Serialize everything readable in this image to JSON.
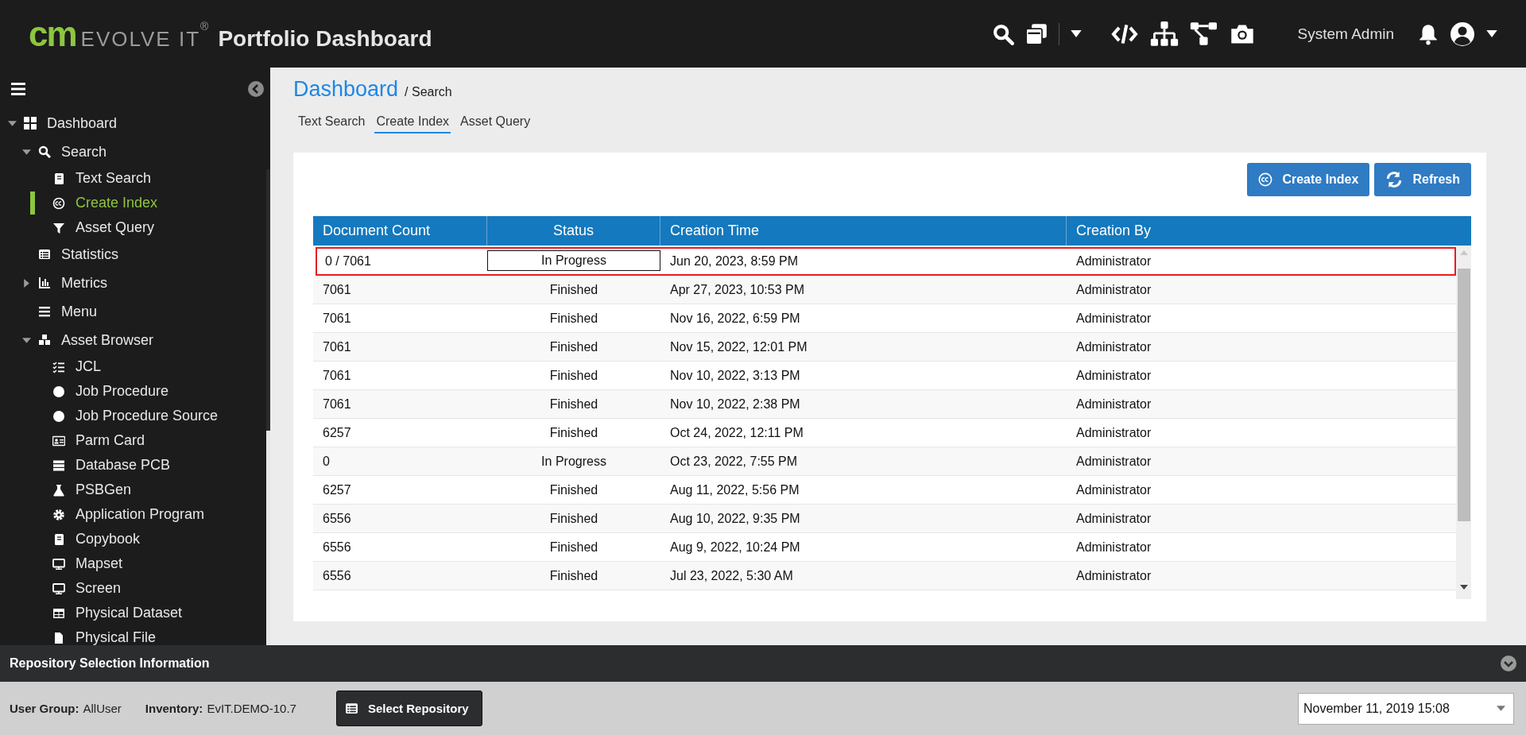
{
  "header": {
    "logo_mark": "cm",
    "logo_word": "EVOLVE IT",
    "logo_reg": "®",
    "title": "Portfolio Dashboard",
    "user": "System Admin"
  },
  "sidebar": {
    "items": [
      {
        "label": "Dashboard",
        "selected": false,
        "expanded": true,
        "children": [
          {
            "label": "Search",
            "selected": false,
            "expanded": true,
            "children": [
              {
                "label": "Text Search",
                "selected": false
              },
              {
                "label": "Create Index",
                "selected": true
              },
              {
                "label": "Asset Query",
                "selected": false
              }
            ]
          },
          {
            "label": "Statistics",
            "selected": false
          },
          {
            "label": "Metrics",
            "selected": false,
            "expanded": false
          },
          {
            "label": "Menu",
            "selected": false
          },
          {
            "label": "Asset Browser",
            "selected": false,
            "expanded": true,
            "children": [
              {
                "label": "JCL",
                "selected": false
              },
              {
                "label": "Job Procedure",
                "selected": false
              },
              {
                "label": "Job Procedure Source",
                "selected": false
              },
              {
                "label": "Parm Card",
                "selected": false
              },
              {
                "label": "Database PCB",
                "selected": false
              },
              {
                "label": "PSBGen",
                "selected": false
              },
              {
                "label": "Application Program",
                "selected": false
              },
              {
                "label": "Copybook",
                "selected": false
              },
              {
                "label": "Mapset",
                "selected": false
              },
              {
                "label": "Screen",
                "selected": false
              },
              {
                "label": "Physical Dataset",
                "selected": false
              },
              {
                "label": "Physical File",
                "selected": false
              }
            ]
          }
        ]
      }
    ]
  },
  "breadcrumb": {
    "title": "Dashboard",
    "path": "/ Search"
  },
  "tabs": [
    {
      "label": "Text Search",
      "selected": false
    },
    {
      "label": "Create Index",
      "selected": true
    },
    {
      "label": "Asset Query",
      "selected": false
    }
  ],
  "buttons": [
    {
      "label": "Create Index",
      "kind": "cc"
    },
    {
      "label": "Refresh",
      "kind": "refresh"
    }
  ],
  "table": {
    "columns": [
      "Document Count",
      "Status",
      "Creation Time",
      "Creation By"
    ],
    "rows": [
      {
        "cells": [
          "0 / 7061",
          "In Progress",
          "Jun 20, 2023, 8:59 PM",
          "Administrator"
        ],
        "highlighted": true
      },
      {
        "cells": [
          "7061",
          "Finished",
          "Apr 27, 2023, 10:53 PM",
          "Administrator"
        ],
        "highlighted": false
      },
      {
        "cells": [
          "7061",
          "Finished",
          "Nov 16, 2022, 6:59 PM",
          "Administrator"
        ],
        "highlighted": false
      },
      {
        "cells": [
          "7061",
          "Finished",
          "Nov 15, 2022, 12:01 PM",
          "Administrator"
        ],
        "highlighted": false
      },
      {
        "cells": [
          "7061",
          "Finished",
          "Nov 10, 2022, 3:13 PM",
          "Administrator"
        ],
        "highlighted": false
      },
      {
        "cells": [
          "7061",
          "Finished",
          "Nov 10, 2022, 2:38 PM",
          "Administrator"
        ],
        "highlighted": false
      },
      {
        "cells": [
          "6257",
          "Finished",
          "Oct 24, 2022, 12:11 PM",
          "Administrator"
        ],
        "highlighted": false
      },
      {
        "cells": [
          "0",
          "In Progress",
          "Oct 23, 2022, 7:55 PM",
          "Administrator"
        ],
        "highlighted": false
      },
      {
        "cells": [
          "6257",
          "Finished",
          "Aug 11, 2022, 5:56 PM",
          "Administrator"
        ],
        "highlighted": false
      },
      {
        "cells": [
          "6556",
          "Finished",
          "Aug 10, 2022, 9:35 PM",
          "Administrator"
        ],
        "highlighted": false
      },
      {
        "cells": [
          "6556",
          "Finished",
          "Aug 9, 2022, 10:24 PM",
          "Administrator"
        ],
        "highlighted": false
      },
      {
        "cells": [
          "6556",
          "Finished",
          "Jul 23, 2022, 5:30 AM",
          "Administrator"
        ],
        "highlighted": false
      }
    ]
  },
  "repository_panel": {
    "title": "Repository Selection Information",
    "user_group_label": "User Group:",
    "user_group": "AllUser",
    "inventory_label": "Inventory:",
    "inventory": "EvIT.DEMO-10.7",
    "button": "Select Repository",
    "date": "November 11, 2019 15:08"
  }
}
